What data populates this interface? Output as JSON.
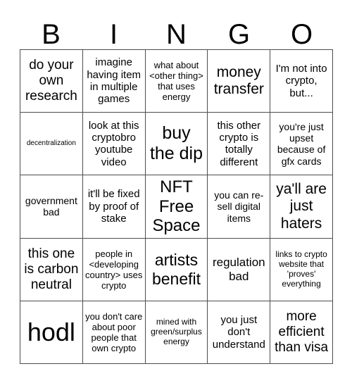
{
  "card": {
    "title": "BINGO",
    "header_letters": [
      "B",
      "I",
      "N",
      "G",
      "O"
    ],
    "border_color": "#4d4d4d",
    "background_color": "#ffffff",
    "text_color": "#000000",
    "rows": 5,
    "columns": 5,
    "free_space_index": 12
  },
  "cells": [
    {
      "text": "do your own research",
      "size": 19
    },
    {
      "text": "imagine having item in multiple games",
      "size": 15
    },
    {
      "text": "what about <other thing> that uses energy",
      "size": 13
    },
    {
      "text": "money transfer",
      "size": 21
    },
    {
      "text": "I'm not into crypto, but...",
      "size": 15
    },
    {
      "text": "decentralization",
      "size": 10
    },
    {
      "text": "look at this cryptobro youtube video",
      "size": 15
    },
    {
      "text": "buy the dip",
      "size": 25
    },
    {
      "text": "this other crypto is totally different",
      "size": 15
    },
    {
      "text": "you're just upset because of gfx cards",
      "size": 14
    },
    {
      "text": "government bad",
      "size": 14
    },
    {
      "text": "it'll be fixed by proof of stake",
      "size": 15
    },
    {
      "text": "NFT Free Space",
      "size": 24
    },
    {
      "text": "you can re-sell digital items",
      "size": 14
    },
    {
      "text": "ya'll are just haters",
      "size": 21
    },
    {
      "text": "this one is carbon neutral",
      "size": 19
    },
    {
      "text": "people in <developing country> uses crypto",
      "size": 13
    },
    {
      "text": "artists benefit",
      "size": 23
    },
    {
      "text": "regulation bad",
      "size": 17
    },
    {
      "text": "links to crypto website that 'proves' everything",
      "size": 12
    },
    {
      "text": "hodl",
      "size": 36
    },
    {
      "text": "you don't care about poor people that own crypto",
      "size": 13
    },
    {
      "text": "mined with green/surplus energy",
      "size": 12
    },
    {
      "text": "you just don't understand",
      "size": 15
    },
    {
      "text": "more efficient than visa",
      "size": 19
    }
  ]
}
